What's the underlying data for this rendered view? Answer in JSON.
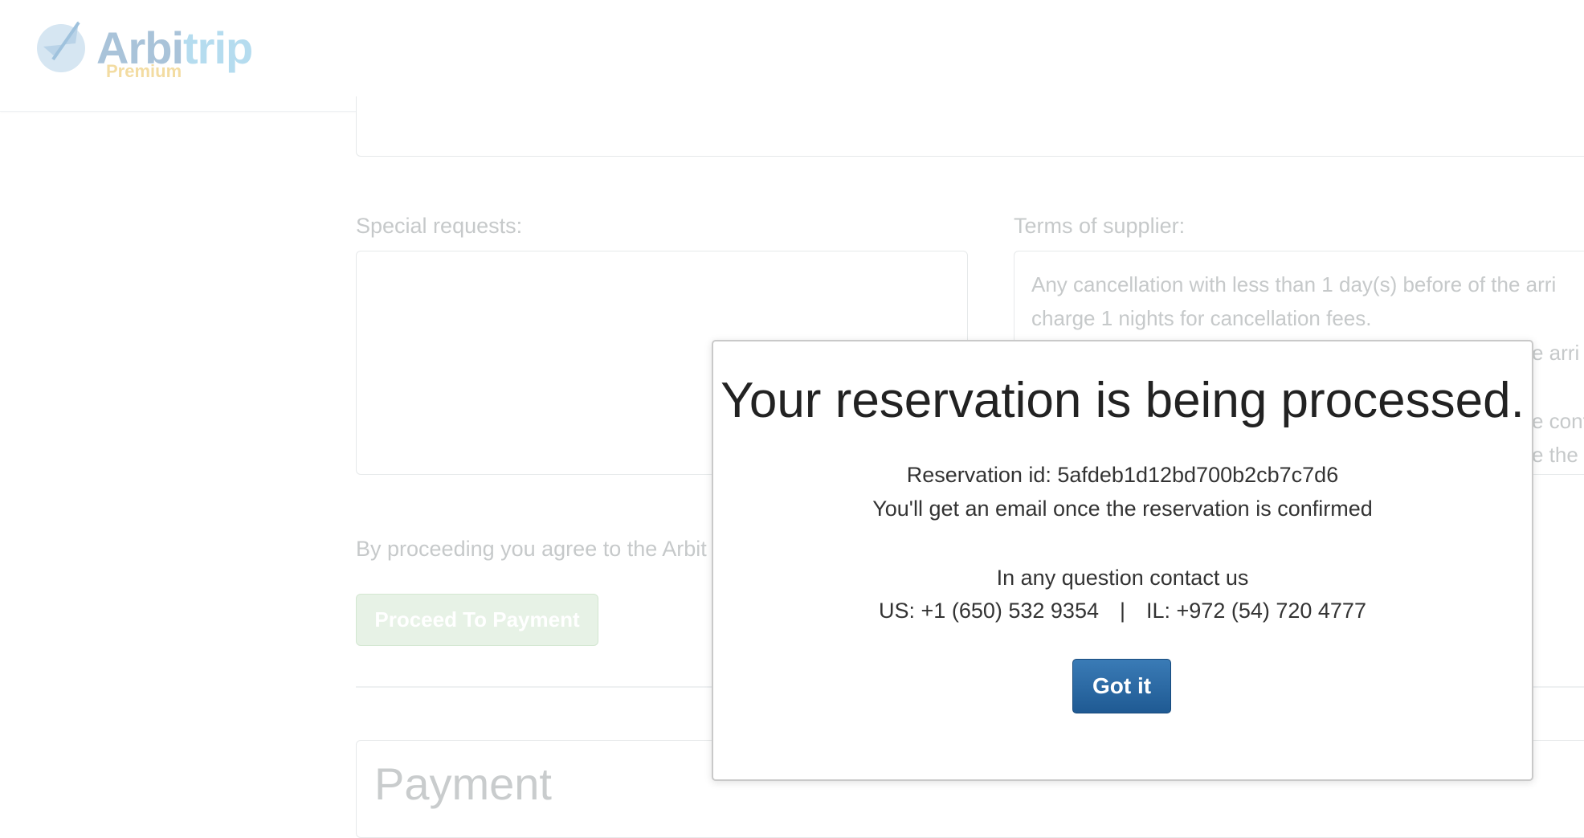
{
  "header": {
    "logo_text_part1": "Arbi",
    "logo_text_part2": "trip",
    "logo_subtitle": "Premium"
  },
  "form": {
    "special_requests_label": "Special requests:",
    "special_requests_value": "",
    "terms_label": "Terms of supplier:",
    "terms_lines": [
      "Any cancellation with less than 1 day(s) before of the arri",
      "charge 1 nights for cancellation fees.",
      "e arri",
      "e cont",
      "e the t"
    ],
    "agree_text": "By proceeding you agree to the Arbit",
    "proceed_button": "Proceed To Payment",
    "payment_title": "Payment"
  },
  "modal": {
    "title": "Your reservation is being processed.",
    "reservation_id_line": "Reservation id: 5afdeb1d12bd700b2cb7c7d6",
    "email_line": "You'll get an email once the reservation is confirmed",
    "contact_line": "In any question contact us",
    "phone_us": "US: +1 (650) 532 9354",
    "phone_separator": "|",
    "phone_il": "IL: +972 (54) 720 4777",
    "button": "Got it"
  },
  "colors": {
    "primary_button": "#2a6aa6",
    "proceed_button_disabled": "#e7f2e6",
    "muted_text": "#c6c9ca"
  }
}
